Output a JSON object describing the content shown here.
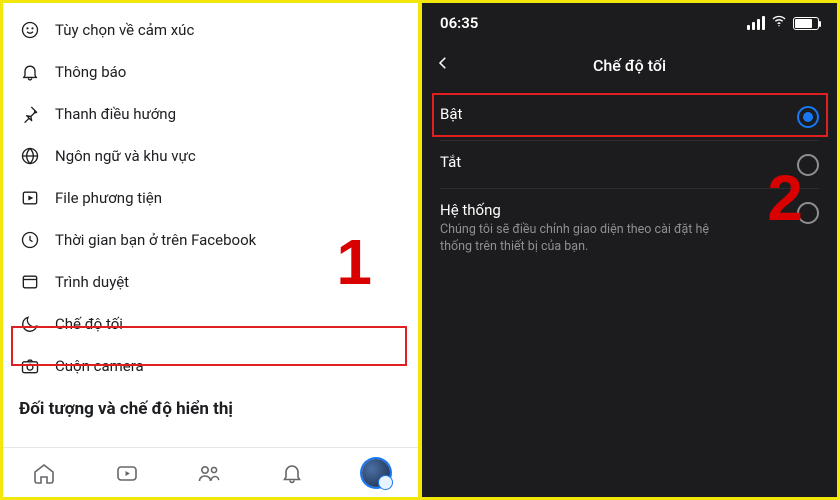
{
  "left": {
    "items": [
      {
        "label": "Tùy chọn về cảm xúc",
        "icon": "smile"
      },
      {
        "label": "Thông báo",
        "icon": "bell"
      },
      {
        "label": "Thanh điều hướng",
        "icon": "pin"
      },
      {
        "label": "Ngôn ngữ và khu vực",
        "icon": "globe"
      },
      {
        "label": "File phương tiện",
        "icon": "media"
      },
      {
        "label": "Thời gian bạn ở trên Facebook",
        "icon": "clock"
      },
      {
        "label": "Trình duyệt",
        "icon": "browser"
      },
      {
        "label": "Chế độ tối",
        "icon": "moon"
      },
      {
        "label": "Cuộn camera",
        "icon": "camera"
      }
    ],
    "section_header": "Đối tượng và chế độ hiển thị",
    "step_label": "1"
  },
  "right": {
    "status_time": "06:35",
    "battery": "79",
    "title": "Chế độ tối",
    "options": {
      "on": {
        "label": "Bật",
        "selected": true
      },
      "off": {
        "label": "Tắt",
        "selected": false
      },
      "sys": {
        "label": "Hệ thống",
        "desc": "Chúng tôi sẽ điều chỉnh giao diện theo cài đặt hệ thống trên thiết bị của bạn.",
        "selected": false
      }
    },
    "step_label": "2"
  }
}
